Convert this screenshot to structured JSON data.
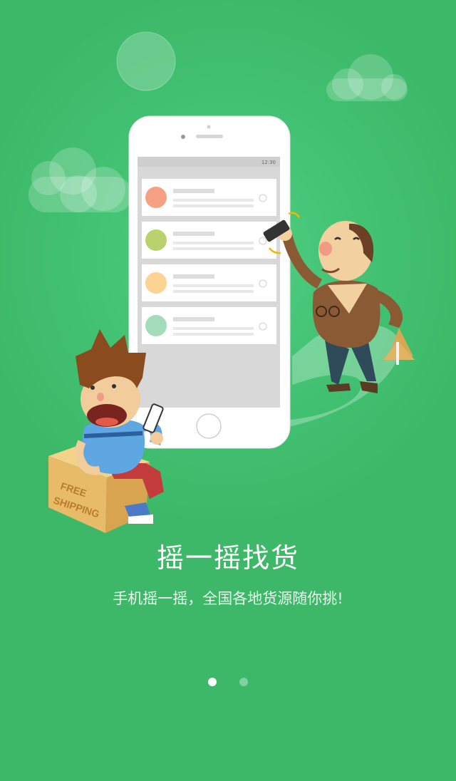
{
  "onboarding": {
    "title": "摇一摇找货",
    "subtitle": "手机摇一摇，全国各地货源随你挑!",
    "page_indicator": {
      "total": 2,
      "current": 1
    }
  },
  "illustration": {
    "phone_status_time": "12:30",
    "box_text_line1": "FREE",
    "box_text_line2": "SHIPPING",
    "list_avatar_colors": [
      "#f6a184",
      "#b9d26e",
      "#fbd393",
      "#a3dcba"
    ]
  },
  "colors": {
    "background": "#3cb868",
    "indicator_active": "#ffffff"
  }
}
